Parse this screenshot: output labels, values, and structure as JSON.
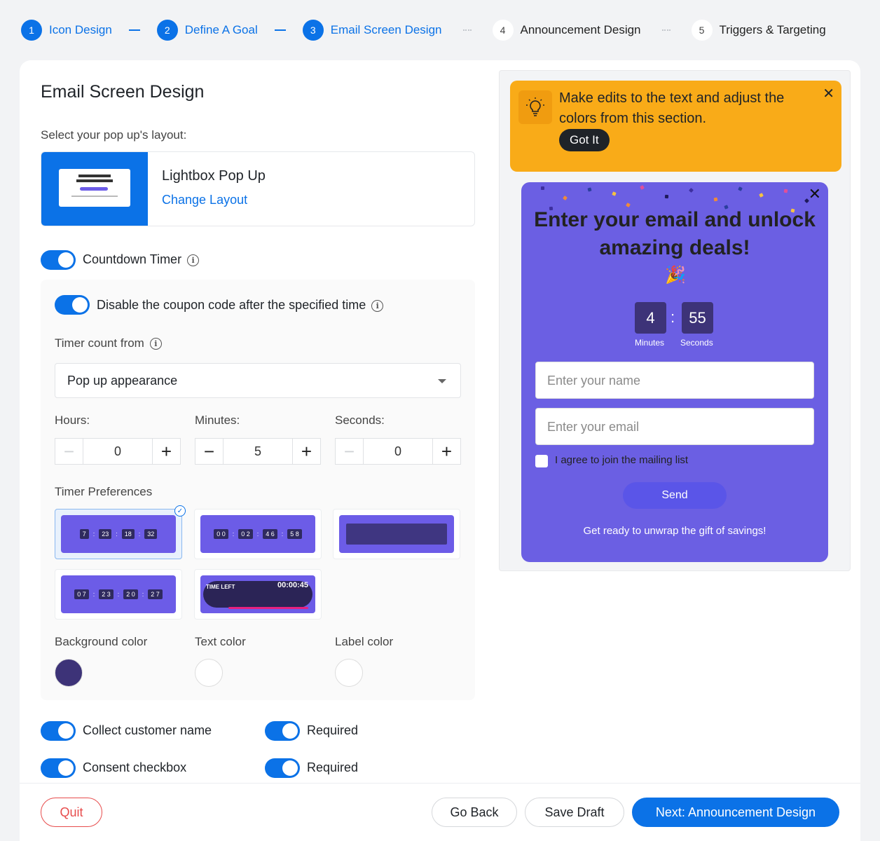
{
  "steps": [
    {
      "num": "1",
      "label": "Icon Design"
    },
    {
      "num": "2",
      "label": "Define A Goal"
    },
    {
      "num": "3",
      "label": "Email Screen Design"
    },
    {
      "num": "4",
      "label": "Announcement Design"
    },
    {
      "num": "5",
      "label": "Triggers & Targeting"
    }
  ],
  "page": {
    "title": "Email Screen Design",
    "layout_prompt": "Select your pop up's layout:",
    "layout_name": "Lightbox Pop Up",
    "change_layout": "Change Layout"
  },
  "countdown": {
    "toggle_label": "Countdown Timer",
    "disable_label": "Disable the coupon code after the specified time",
    "count_from_label": "Timer count from",
    "count_from_value": "Pop up appearance",
    "hours_label": "Hours:",
    "hours_value": "0",
    "minutes_label": "Minutes:",
    "minutes_value": "5",
    "seconds_label": "Seconds:",
    "seconds_value": "0",
    "preferences_label": "Timer Preferences",
    "bg_color_label": "Background color",
    "text_color_label": "Text color",
    "label_color_label": "Label color",
    "bg_color": "#3d3378",
    "text_color": "#ffffff",
    "label_color": "#ffffff"
  },
  "options": {
    "collect_name": "Collect customer name",
    "required_1": "Required",
    "consent": "Consent checkbox",
    "required_2": "Required"
  },
  "footer": {
    "quit": "Quit",
    "back": "Go Back",
    "save": "Save Draft",
    "next": "Next: Announcement Design"
  },
  "tip": {
    "text": "Make edits to the text and adjust the colors from this section.",
    "button": "Got It"
  },
  "popup": {
    "headline": "Enter your email and unlock amazing deals!",
    "minutes": "4",
    "seconds": "55",
    "minutes_label": "Minutes",
    "seconds_label": "Seconds",
    "name_placeholder": "Enter your name",
    "email_placeholder": "Enter your email",
    "checkbox_label": "I agree to join the mailing list",
    "send": "Send",
    "footer_text": "Get ready to unwrap the gift of savings!"
  },
  "colors": {
    "accent": "#0b72e7",
    "popup_bg": "#6b5fe3",
    "tip_bg": "#f9ab18"
  }
}
